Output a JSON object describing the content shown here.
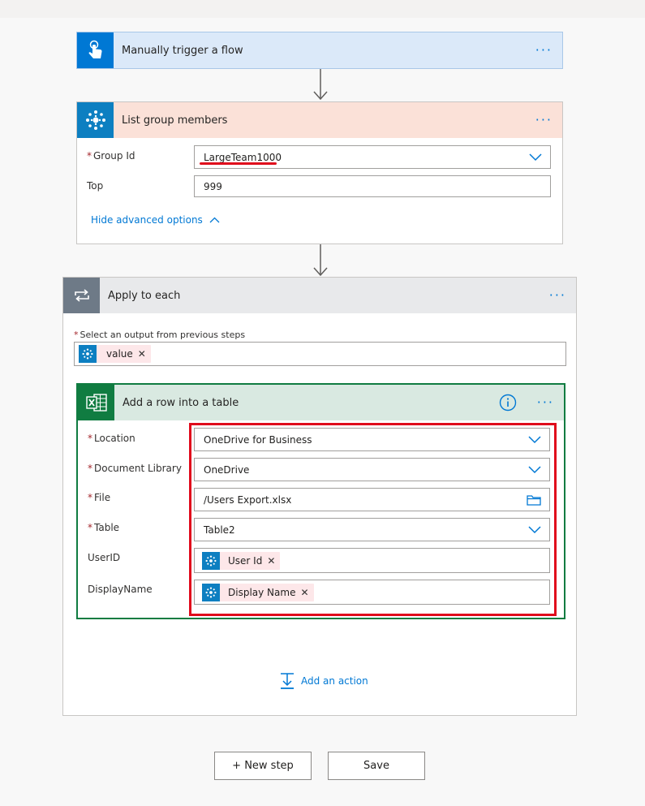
{
  "trigger": {
    "title": "Manually trigger a flow",
    "icon": "touch-icon",
    "color": "#0078d4",
    "bg": "#dbe9f9"
  },
  "list_members": {
    "title": "List group members",
    "icon": "group-network-icon",
    "color": "#0d7fc1",
    "bg": "#fbe1d8",
    "fields": [
      {
        "label": "Group Id",
        "required": true,
        "value": "LargeTeam1000"
      },
      {
        "label": "Top",
        "required": false,
        "value": "999"
      }
    ],
    "advanced_link": "Hide advanced options"
  },
  "apply_each": {
    "title": "Apply to each",
    "icon": "loop-icon",
    "output_label": "Select an output from previous steps",
    "output_token": "value"
  },
  "add_row": {
    "title": "Add a row into a table",
    "icon": "excel-icon",
    "color": "#107c41",
    "bg": "#d9e9e1",
    "fields": [
      {
        "label": "Location",
        "required": true,
        "value": "OneDrive for Business"
      },
      {
        "label": "Document Library",
        "required": true,
        "value": "OneDrive"
      },
      {
        "label": "File",
        "required": true,
        "value": "/Users Export.xlsx"
      },
      {
        "label": "Table",
        "required": true,
        "value": "Table2"
      },
      {
        "label": "UserID",
        "required": false,
        "token": "User Id"
      },
      {
        "label": "DisplayName",
        "required": false,
        "token": "Display Name"
      }
    ]
  },
  "add_action": "Add an action",
  "buttons": {
    "new_step": "+ New step",
    "save": "Save"
  },
  "more_menu": "···"
}
